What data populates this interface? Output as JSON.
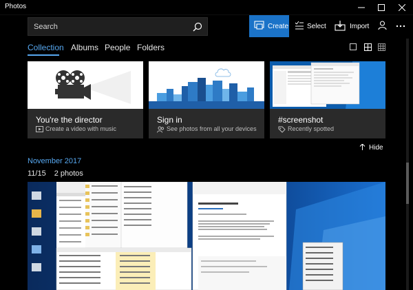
{
  "window": {
    "title": "Photos"
  },
  "toolbar": {
    "search_placeholder": "Search",
    "create_label": "Create",
    "select_label": "Select",
    "import_label": "Import"
  },
  "nav": {
    "items": [
      "Collection",
      "Albums",
      "People",
      "Folders"
    ],
    "active": "Collection"
  },
  "cards": [
    {
      "title": "You're the director",
      "subtitle": "Create a video with music",
      "icon": "video-icon"
    },
    {
      "title": "Sign in",
      "subtitle": "See photos from all your devices",
      "icon": "people-icon"
    },
    {
      "title": "#screenshot",
      "subtitle": "Recently spotted",
      "icon": "tag-icon"
    }
  ],
  "hide_label": "Hide",
  "section": {
    "month": "November 2017",
    "date": "11/15",
    "count": "2 photos"
  },
  "colors": {
    "accent": "#1b73c8",
    "link": "#57a8f0",
    "background": "#000000",
    "card": "#2a2a2a"
  }
}
